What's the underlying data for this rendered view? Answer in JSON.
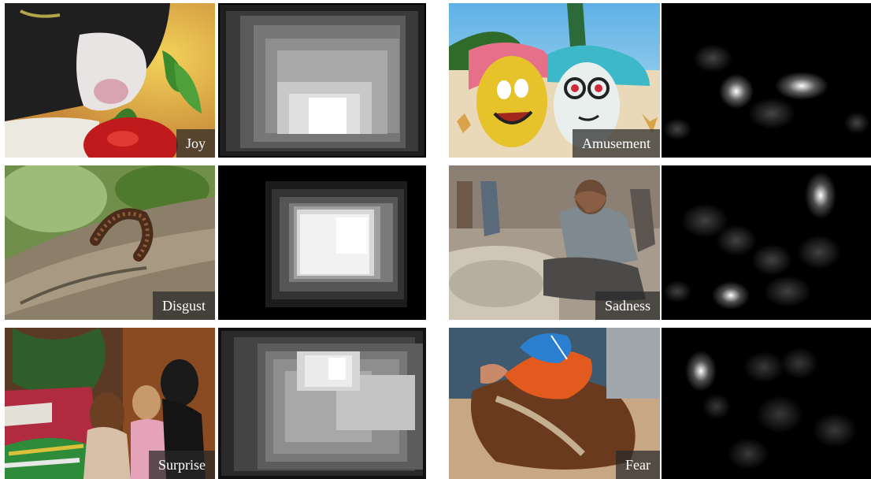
{
  "figure": {
    "panels": [
      {
        "emotion": "Joy"
      },
      {
        "emotion": "Amusement"
      },
      {
        "emotion": "Disgust"
      },
      {
        "emotion": "Sadness"
      },
      {
        "emotion": "Surprise"
      },
      {
        "emotion": "Fear"
      }
    ]
  }
}
